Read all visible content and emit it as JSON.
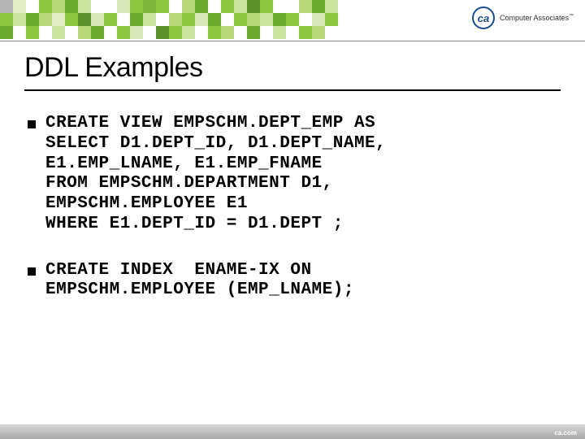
{
  "brand": {
    "logo_text": "ca",
    "name": "Computer Associates",
    "tm": "™"
  },
  "title": "DDL Examples",
  "bullets": [
    "CREATE VIEW EMPSCHM.DEPT_EMP AS\nSELECT D1.DEPT_ID, D1.DEPT_NAME,\nE1.EMP_LNAME, E1.EMP_FNAME\nFROM EMPSCHM.DEPARTMENT D1,\nEMPSCHM.EMPLOYEE E1\nWHERE E1.DEPT_ID = D1.DEPT ;",
    "CREATE INDEX  ENAME-IX ON\nEMPSCHM.EMPLOYEE (EMP_LNAME);"
  ],
  "footer": "ca.com",
  "mosaic_colors": [
    [
      "#b7b7b7",
      "#e5efc9",
      "#ffffff",
      "#8fc641",
      "#b7d77a",
      "#6aa72d",
      "#cde1a0",
      "#ffffff",
      "#ffffff",
      "#d7e7b8",
      "#8fc641",
      "#7fb53b",
      "#8fc641",
      "#ffffff",
      "#b7d77a",
      "#6aa72d",
      "#ffffff",
      "#8fc641",
      "#cde1a0",
      "#5a8f2a",
      "#8fc641",
      "#ffffff",
      "#ffffff",
      "#b7d77a",
      "#6aa72d",
      "#cde1a0"
    ],
    [
      "#8fc641",
      "#cde1a0",
      "#6aa72d",
      "#b7d77a",
      "#e5efc9",
      "#8fc641",
      "#5a8f2a",
      "#d7e7b8",
      "#8fc641",
      "#ffffff",
      "#6aa72d",
      "#cde1a0",
      "#ffffff",
      "#b7d77a",
      "#8fc641",
      "#d7e7b8",
      "#6aa72d",
      "#ffffff",
      "#8fc641",
      "#b7d77a",
      "#cde1a0",
      "#6aa72d",
      "#8fc641",
      "#ffffff",
      "#d7e7b8",
      "#8fc641"
    ],
    [
      "#6aa72d",
      "#ffffff",
      "#8fc641",
      "#ffffff",
      "#cde1a0",
      "#ffffff",
      "#b7d77a",
      "#6aa72d",
      "#ffffff",
      "#8fc641",
      "#d7e7b8",
      "#ffffff",
      "#5a8f2a",
      "#8fc641",
      "#cde1a0",
      "#ffffff",
      "#8fc641",
      "#b7d77a",
      "#ffffff",
      "#6aa72d",
      "#ffffff",
      "#cde1a0",
      "#ffffff",
      "#8fc641",
      "#b7d77a",
      "#ffffff"
    ]
  ]
}
